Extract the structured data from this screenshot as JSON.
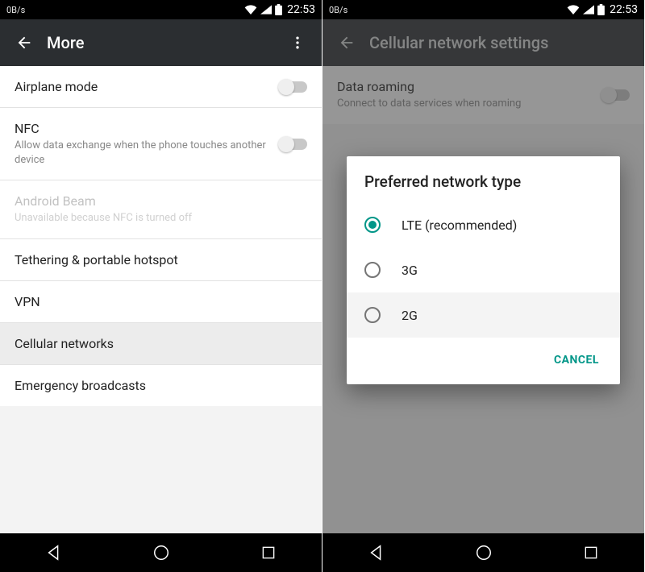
{
  "status": {
    "net_speed": "0B/s",
    "time": "22:53"
  },
  "left": {
    "title": "More",
    "items": [
      {
        "title": "Airplane mode",
        "sub": "",
        "toggle": true
      },
      {
        "title": "NFC",
        "sub": "Allow data exchange when the phone touches another device",
        "toggle": true
      },
      {
        "title": "Android Beam",
        "sub": "Unavailable because NFC is turned off",
        "disabled": true
      },
      {
        "title": "Tethering & portable hotspot"
      },
      {
        "title": "VPN"
      },
      {
        "title": "Cellular networks",
        "selected": true
      },
      {
        "title": "Emergency broadcasts"
      }
    ]
  },
  "right": {
    "title": "Cellular network settings",
    "bg_items": [
      {
        "title": "Data roaming",
        "sub": "Connect to data services when roaming",
        "toggle": true
      }
    ],
    "dialog": {
      "title": "Preferred network type",
      "options": [
        {
          "label": "LTE (recommended)",
          "checked": true
        },
        {
          "label": "3G",
          "checked": false
        },
        {
          "label": "2G",
          "checked": false
        }
      ],
      "cancel": "CANCEL"
    }
  }
}
